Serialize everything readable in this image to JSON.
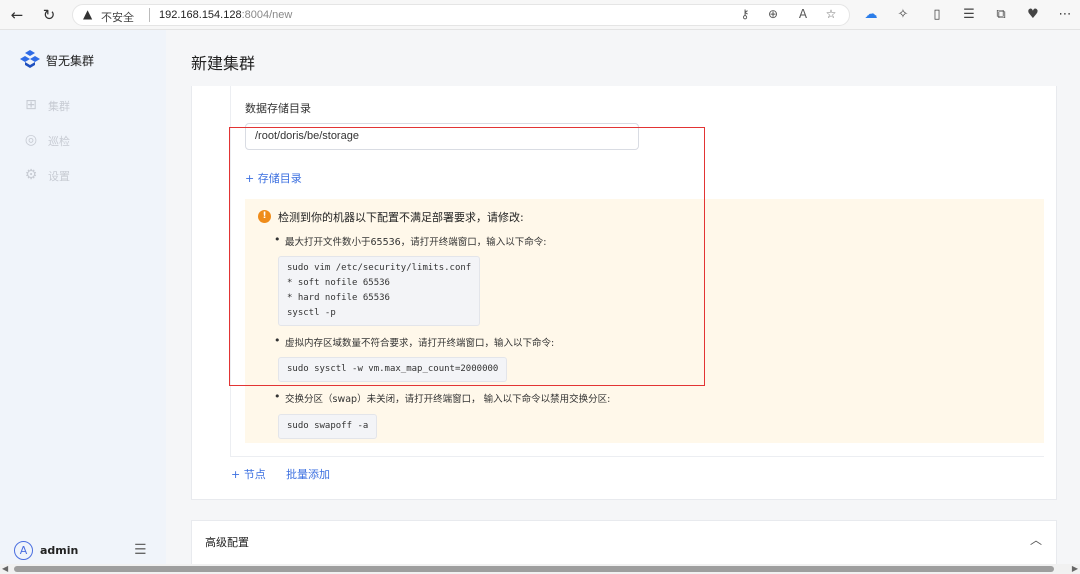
{
  "browser": {
    "security_label": "不安全",
    "url_host": "192.168.154.128",
    "url_rest": ":8004/new"
  },
  "sidebar": {
    "brand": "智无集群",
    "items": [
      {
        "label": "集群",
        "icon": "cluster-icon"
      },
      {
        "label": "巡检",
        "icon": "inspect-icon"
      },
      {
        "label": "设置",
        "icon": "gear-icon"
      }
    ],
    "user": {
      "avatar": "A",
      "name": "admin"
    }
  },
  "main": {
    "title": "新建集群",
    "storage": {
      "label": "数据存储目录",
      "value": "/root/doris/be/storage",
      "add_label": "+ 存储目录"
    },
    "warning": {
      "title": "检测到你的机器以下配置不满足部署要求，请修改:",
      "items": [
        {
          "text": "最大打开文件数小于65536，请打开终端窗口，输入以下命令:",
          "code": "sudo vim /etc/security/limits.conf\n* soft nofile 65536\n* hard nofile 65536\nsysctl -p"
        },
        {
          "text": "虚拟内存区域数量不符合要求，请打开终端窗口，输入以下命令:",
          "code": "sudo sysctl -w vm.max_map_count=2000000"
        },
        {
          "text": "交换分区（swap）未关闭，请打开终端窗口， 输入以下命令以禁用交换分区:",
          "code": "sudo swapoff -a"
        }
      ]
    },
    "add_node": "+ 节点",
    "batch_add": "批量添加",
    "advanced": "高级配置"
  },
  "colors": {
    "accent": "#3b6fe0",
    "warning": "#ef8c1a",
    "highlight": "#e23434"
  }
}
